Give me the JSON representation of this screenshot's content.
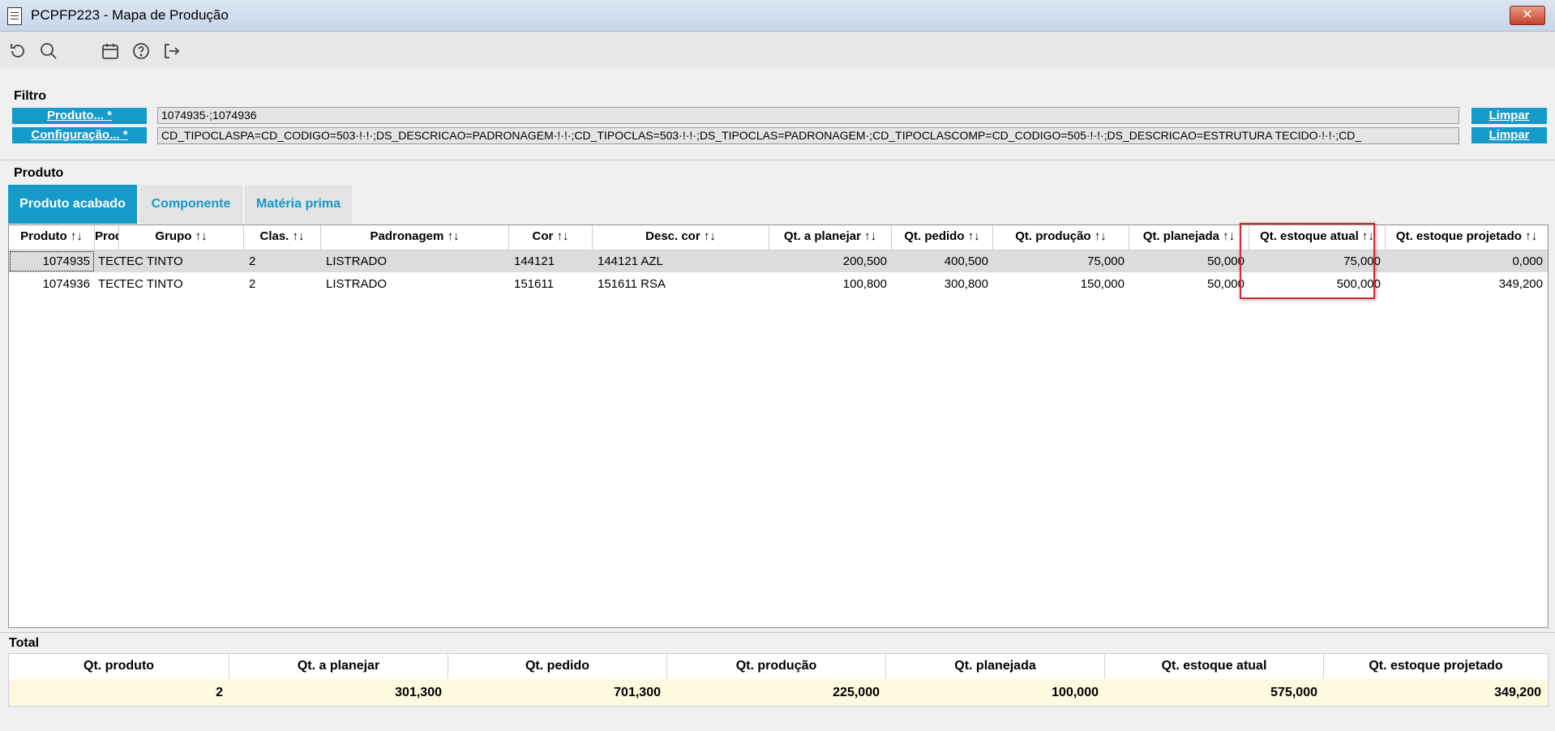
{
  "window": {
    "title": "PCPFP223 - Mapa de Produção",
    "close_label": "✕"
  },
  "toolbar": {
    "icons": [
      "refresh-icon",
      "search-icon",
      "calendar-icon",
      "help-icon",
      "exit-icon"
    ]
  },
  "filter": {
    "section_label": "Filtro",
    "produto_label": "Produto... *",
    "produto_value": "1074935·;1074936",
    "config_label": "Configuração... *",
    "config_value": "CD_TIPOCLASPA=CD_CODIGO=503·!·!·;DS_DESCRICAO=PADRONAGEM·!·!·;CD_TIPOCLAS=503·!·!·;DS_TIPOCLAS=PADRONAGEM·;CD_TIPOCLASCOMP=CD_CODIGO=505·!·!·;DS_DESCRICAO=ESTRUTURA TECIDO·!·!·;CD_",
    "limpar_label": "Limpar"
  },
  "produto": {
    "section_label": "Produto",
    "tabs": [
      "Produto acabado",
      "Componente",
      "Matéria prima"
    ]
  },
  "grid": {
    "columns": [
      "Produto ↑↓",
      "Produto",
      "Grupo ↑↓",
      "Clas. ↑↓",
      "Padronagem ↑↓",
      "Cor ↑↓",
      "Desc. cor ↑↓",
      "Qt. a planejar ↑↓",
      "Qt. pedido ↑↓",
      "Qt. produção ↑↓",
      "Qt. planejada ↑↓",
      "Qt. estoque atual ↑↓",
      "Qt. estoque projetado ↑↓"
    ],
    "rows": [
      [
        "1074935",
        "TEC",
        "TEC TINTO",
        "2",
        "LISTRADO",
        "144121",
        "144121 AZL",
        "200,500",
        "400,500",
        "75,000",
        "50,000",
        "75,000",
        "0,000"
      ],
      [
        "1074936",
        "TEC",
        "TEC TINTO",
        "2",
        "LISTRADO",
        "151611",
        "151611 RSA",
        "100,800",
        "300,800",
        "150,000",
        "50,000",
        "500,000",
        "349,200"
      ]
    ]
  },
  "total": {
    "section_label": "Total",
    "headers": [
      "Qt. produto",
      "Qt. a planejar",
      "Qt. pedido",
      "Qt. produção",
      "Qt. planejada",
      "Qt. estoque atual",
      "Qt. estoque projetado"
    ],
    "values": [
      "2",
      "301,300",
      "701,300",
      "225,000",
      "100,000",
      "575,000",
      "349,200"
    ]
  },
  "colors": {
    "accent": "#159ac9",
    "highlight": "#d9262b",
    "selected_row": "#dcdcdc",
    "total_row": "#fdfadf"
  }
}
